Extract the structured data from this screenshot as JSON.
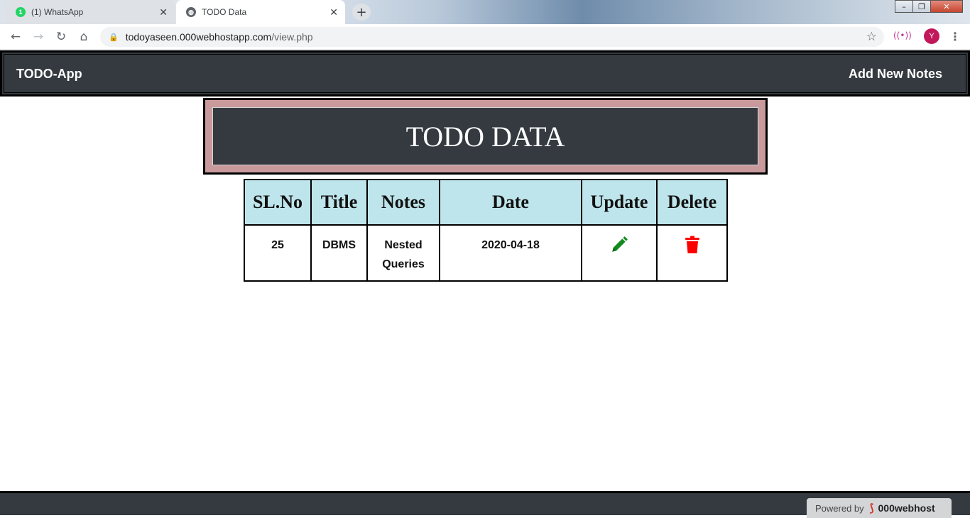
{
  "browser": {
    "tabs": [
      {
        "title": "(1) WhatsApp",
        "badge": "1",
        "active": false
      },
      {
        "title": "TODO Data",
        "active": true
      }
    ],
    "url_host": "todoyaseen.000webhostapp.com",
    "url_path": "/view.php",
    "profile_initial": "Y"
  },
  "navbar": {
    "brand": "TODO-App",
    "link": "Add New Notes"
  },
  "header": {
    "title": "TODO DATA"
  },
  "table": {
    "headers": [
      "SL.No",
      "Title",
      "Notes",
      "Date",
      "Update",
      "Delete"
    ],
    "rows": [
      {
        "sl": "25",
        "title": "DBMS",
        "notes_line1": "Nested",
        "notes_line2": "Queries",
        "date": "2020-04-18"
      }
    ]
  },
  "footer": {
    "powered_by": "Powered by",
    "host_name": "000webhost"
  },
  "colors": {
    "navbar_bg": "#343a40",
    "header_frame": "#c99a9c",
    "table_head_bg": "#bee5eb",
    "update_icon": "#138a1e",
    "delete_icon": "#ff0000"
  }
}
